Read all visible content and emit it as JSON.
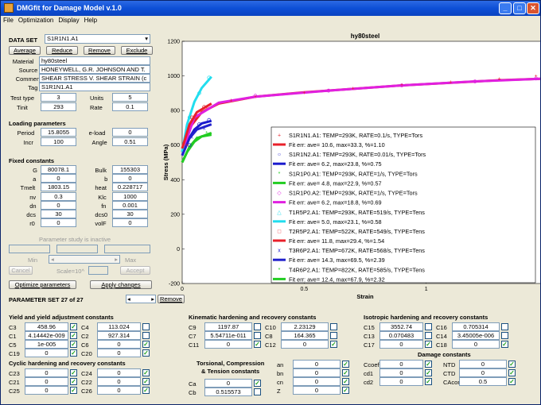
{
  "window": {
    "title": "DMGfit for Damage Model v.1.0"
  },
  "menu": [
    "File",
    "Optimization",
    "Display",
    "Help"
  ],
  "dataset": {
    "label": "DATA SET",
    "value": "S1R1N1.A1",
    "buttons": [
      "Average",
      "Reduce",
      "Remove",
      "Exclude"
    ]
  },
  "meta": [
    {
      "label": "Material",
      "value": "hy80steel"
    },
    {
      "label": "Source",
      "value": "HONEYWELL, G.R. JOHNSON AND T."
    },
    {
      "label": "Comment",
      "value": "SHEAR STRESS V. SHEAR STRAIN (c"
    },
    {
      "label": "Tag",
      "value": "S1R1N1.A1"
    }
  ],
  "testtype": {
    "label": "Test type",
    "value": "3",
    "units_label": "Units",
    "units_value": "5"
  },
  "tinit": {
    "label": "Tinit",
    "value": "293",
    "rate_label": "Rate",
    "rate_value": "0.1"
  },
  "loading": {
    "title": "Loading parameters",
    "rows": [
      {
        "l1": "Period",
        "v1": "15.8055",
        "l2": "e-load",
        "v2": "0"
      },
      {
        "l1": "Incr",
        "v1": "100",
        "l2": "Angle",
        "v2": "0.51"
      }
    ]
  },
  "fixed": {
    "title": "Fixed constants",
    "rows": [
      {
        "l1": "G",
        "v1": "80078.1",
        "l2": "Bulk",
        "v2": "155303"
      },
      {
        "l1": "a",
        "v1": "0",
        "l2": "b",
        "v2": "0"
      },
      {
        "l1": "Tmelt",
        "v1": "1803.15",
        "l2": "heat",
        "v2": "0.228717"
      },
      {
        "l1": "nv",
        "v1": "0.3",
        "l2": "Klc",
        "v2": "1000"
      },
      {
        "l1": "dn",
        "v1": "0",
        "l2": "fn",
        "v2": "0.001"
      },
      {
        "l1": "dcs",
        "v1": "30",
        "l2": "dcs0",
        "v2": "30"
      },
      {
        "l1": "r0",
        "v1": "0",
        "l2": "volF",
        "v2": "0"
      }
    ]
  },
  "param_study": {
    "status": "Parameter study is inactive",
    "min": "Min",
    "max": "Max",
    "cancel": "Cancel",
    "scale": "Scale=10^",
    "accept": "Accept"
  },
  "actions": {
    "optimize": "Optimize parameters",
    "apply": "Apply changes"
  },
  "paramset": {
    "label": "PARAMETER SET 27 of 27",
    "remove": "Remove"
  },
  "groups": [
    {
      "title": "Yield and yield adjustment constants",
      "rows": [
        {
          "n1": "C3",
          "v1": "458.96",
          "c1": true,
          "n2": "C4",
          "v2": "113.024",
          "c2": false
        },
        {
          "n1": "C1",
          "v1": "4.14442e-009",
          "c1": true,
          "n2": "C2",
          "v2": "927.314",
          "c2": false
        },
        {
          "n1": "C5",
          "v1": "1e-005",
          "c1": true,
          "n2": "C6",
          "v2": "0",
          "c2": true
        },
        {
          "n1": "C19",
          "v1": "0",
          "c1": true,
          "n2": "C20",
          "v2": "0",
          "c2": true
        }
      ]
    },
    {
      "title": "Cyclic hardening and recovery constants",
      "rows": [
        {
          "n1": "C23",
          "v1": "0",
          "c1": true,
          "n2": "C24",
          "v2": "0",
          "c2": true
        },
        {
          "n1": "C21",
          "v1": "0",
          "c1": true,
          "n2": "C22",
          "v2": "0",
          "c2": true
        },
        {
          "n1": "C25",
          "v1": "0",
          "c1": true,
          "n2": "C26",
          "v2": "0",
          "c2": true
        }
      ]
    },
    {
      "title": "Kinematic hardening and recovery constants",
      "rows": [
        {
          "n1": "C9",
          "v1": "1197.87",
          "c1": false,
          "n2": "C10",
          "v2": "2.23129",
          "c2": false
        },
        {
          "n1": "C7",
          "v1": "5.54711e-011",
          "c1": false,
          "n2": "C8",
          "v2": "164.365",
          "c2": false
        },
        {
          "n1": "C11",
          "v1": "0",
          "c1": true,
          "n2": "C12",
          "v2": "0",
          "c2": true
        }
      ]
    },
    {
      "title": "Isotropic hardening and recovery constants",
      "rows": [
        {
          "n1": "C15",
          "v1": "3552.74",
          "c1": false,
          "n2": "C16",
          "v2": "0.705314",
          "c2": false
        },
        {
          "n1": "C13",
          "v1": "0.070483",
          "c1": false,
          "n2": "C14",
          "v2": "3.45005e-006",
          "c2": false
        },
        {
          "n1": "C17",
          "v1": "0",
          "c1": true,
          "n2": "C18",
          "v2": "0",
          "c2": true
        }
      ]
    }
  ],
  "torsional": {
    "title1": "Torsional, Compression",
    "title2": "& Tension constants",
    "rows": [
      {
        "n": "Ca",
        "v": "0",
        "c": true
      },
      {
        "n": "Cb",
        "v": "0.515573",
        "c": false
      }
    ]
  },
  "misc": {
    "rows": [
      {
        "n": "an",
        "v": "0",
        "c": true
      },
      {
        "n": "bn",
        "v": "0",
        "c": true
      },
      {
        "n": "cn",
        "v": "0",
        "c": true
      },
      {
        "n": "Z",
        "v": "0",
        "c": true
      }
    ]
  },
  "damage": {
    "title": "Damage constants",
    "rows": [
      {
        "n1": "Ccoef",
        "v1": "0",
        "c1": true,
        "n2": "NTD",
        "v2": "0",
        "c2": true
      },
      {
        "n1": "cd1",
        "v1": "0",
        "c1": true,
        "n2": "CTD",
        "v2": "0",
        "c2": true
      },
      {
        "n1": "cd2",
        "v1": "0",
        "c1": true,
        "n2": "CAcon",
        "v2": "0.5",
        "c2": true
      }
    ]
  },
  "chart_data": {
    "type": "scatter",
    "title": "hy80steel",
    "xlabel": "Strain",
    "ylabel": "Stress (MPa)",
    "xlim": [
      0,
      1.5
    ],
    "ylim": [
      -200,
      1200
    ],
    "xticks": [
      0,
      0.5,
      1,
      1.5
    ],
    "yticks": [
      -200,
      0,
      200,
      400,
      600,
      800,
      1000,
      1200
    ],
    "series": [
      {
        "name": "S1R1N1.A1: TEMP=293K, RATE=0.1/s, TYPE=Tors",
        "fit": "Fit err: ave= 10.6, max=33.3, %=1.10",
        "color": "#e8202a",
        "marker": "+",
        "points": [
          [
            0.02,
            600
          ],
          [
            0.05,
            760
          ],
          [
            0.1,
            820
          ],
          [
            0.2,
            860
          ],
          [
            0.3,
            880
          ],
          [
            0.5,
            905
          ],
          [
            0.7,
            930
          ],
          [
            0.9,
            950
          ],
          [
            1.1,
            965
          ],
          [
            1.3,
            985
          ],
          [
            1.45,
            1000
          ]
        ],
        "fitline": [
          [
            0,
            560
          ],
          [
            0.03,
            700
          ],
          [
            0.08,
            790
          ],
          [
            0.15,
            840
          ],
          [
            0.3,
            880
          ],
          [
            0.5,
            905
          ],
          [
            0.7,
            925
          ],
          [
            0.9,
            945
          ],
          [
            1.1,
            960
          ],
          [
            1.3,
            975
          ],
          [
            1.5,
            985
          ]
        ],
        "end": null
      },
      {
        "name": "S1R1N2.A1: TEMP=293K, RATE=0.01/s, TYPE=Tors",
        "fit": "Fit err: ave= 6.2, max=23.8, %=0.75",
        "color": "#1a1acd",
        "marker": "o",
        "points": [
          [
            0.03,
            600
          ],
          [
            0.07,
            720
          ],
          [
            0.11,
            745
          ]
        ],
        "fitline": [
          [
            0,
            540
          ],
          [
            0.02,
            620
          ],
          [
            0.05,
            690
          ],
          [
            0.08,
            725
          ],
          [
            0.12,
            740
          ]
        ],
        "end": 0.12
      },
      {
        "name": "S1R1P0.A1: TEMP=293K, RATE=1/s, TYPE=Tors",
        "fit": "Fit err: ave= 4.8, max=22.9, %=0.57",
        "color": "#22cc22",
        "marker": "*",
        "points": [
          [
            0.02,
            560
          ],
          [
            0.06,
            640
          ],
          [
            0.1,
            670
          ]
        ],
        "fitline": [
          [
            0,
            500
          ],
          [
            0.02,
            560
          ],
          [
            0.05,
            620
          ],
          [
            0.08,
            650
          ],
          [
            0.12,
            660
          ]
        ],
        "end": 0.12
      },
      {
        "name": "S1R1P0.A2: TEMP=293K, RATE=1/s, TYPE=Tors",
        "fit": "Fit err: ave= 6.2, max=18.8, %=0.69",
        "color": "#e020e0",
        "marker": "d",
        "points": [
          [
            0.3,
            885
          ],
          [
            0.6,
            915
          ],
          [
            0.9,
            945
          ],
          [
            1.2,
            968
          ],
          [
            1.45,
            985
          ]
        ],
        "fitline": [
          [
            0,
            560
          ],
          [
            0.05,
            760
          ],
          [
            0.15,
            845
          ],
          [
            0.3,
            880
          ],
          [
            0.6,
            915
          ],
          [
            0.9,
            945
          ],
          [
            1.2,
            968
          ],
          [
            1.5,
            985
          ]
        ],
        "end": null
      },
      {
        "name": "T1R5P2.A1: TEMP=293K, RATE=519/s, TYPE=Tens",
        "fit": "Fit err: ave= 5.0, max=23.1, %=0.58",
        "color": "#22ddee",
        "marker": "^",
        "points": [
          [
            0.03,
            760
          ],
          [
            0.07,
            900
          ],
          [
            0.11,
            990
          ]
        ],
        "fitline": [
          [
            0,
            560
          ],
          [
            0.02,
            720
          ],
          [
            0.05,
            850
          ],
          [
            0.08,
            930
          ],
          [
            0.12,
            995
          ]
        ],
        "end": 0.12
      },
      {
        "name": "T2R5P2.A1: TEMP=522K, RATE=549/s, TYPE=Tens",
        "fit": "Fit err: ave= 11.8, max=29.4, %=1.54",
        "color": "#e8202a",
        "marker": "s",
        "points": [
          [
            0.04,
            760
          ],
          [
            0.09,
            820
          ]
        ],
        "fitline": [
          [
            0,
            580
          ],
          [
            0.03,
            720
          ],
          [
            0.06,
            790
          ],
          [
            0.12,
            840
          ]
        ],
        "end": 0.12
      },
      {
        "name": "T3R6P2.A1: TEMP=672K, RATE=568/s, TYPE=Tens",
        "fit": "Fit err: ave= 14.3, max=69.5, %=2.39",
        "color": "#2222cc",
        "marker": "x",
        "points": [
          [
            0.04,
            650
          ],
          [
            0.09,
            700
          ]
        ],
        "fitline": [
          [
            0,
            540
          ],
          [
            0.03,
            640
          ],
          [
            0.06,
            690
          ],
          [
            0.12,
            720
          ]
        ],
        "end": 0.12
      },
      {
        "name": "T4R6P2.A1: TEMP=822K, RATE=585/s, TYPE=Tens",
        "fit": "Fit err: ave= 12.4, max=67.9, %=2.32",
        "color": "#22cc22",
        "marker": "*",
        "points": [
          [
            0.04,
            600
          ],
          [
            0.09,
            650
          ]
        ],
        "fitline": [
          [
            0,
            500
          ],
          [
            0.03,
            590
          ],
          [
            0.06,
            640
          ],
          [
            0.12,
            670
          ]
        ],
        "end": 0.12
      }
    ]
  }
}
